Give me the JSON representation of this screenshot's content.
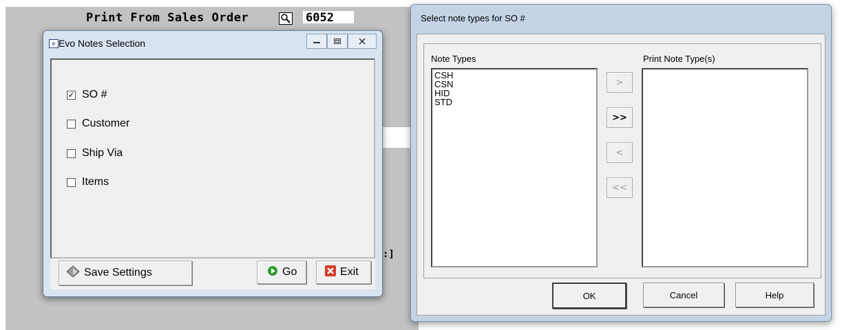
{
  "background_app": {
    "title_line": "Print From Sales Order",
    "order_number": "6052",
    "partial_text": ":]"
  },
  "evo_window": {
    "title": "Evo Notes Selection",
    "app_icon": "document-icon",
    "controls": {
      "minimize": "minimize-icon",
      "restore": "restore-icon",
      "close": "close-icon"
    },
    "checkboxes": [
      {
        "label": "SO #",
        "checked": true
      },
      {
        "label": "Customer",
        "checked": false
      },
      {
        "label": "Ship Via",
        "checked": false
      },
      {
        "label": "Items",
        "checked": false
      }
    ],
    "buttons": {
      "save_settings": "Save Settings",
      "go": "Go",
      "exit": "Exit"
    }
  },
  "note_dialog": {
    "title": "Select note types for SO #",
    "note_types_label": "Note Types",
    "print_note_types_label": "Print Note Type(s)",
    "note_types": [
      "CSH",
      "CSN",
      "HID",
      "STD"
    ],
    "print_note_types": [],
    "arrow_buttons": {
      "add_one": ">",
      "add_all": ">>",
      "remove_one": "<",
      "remove_all": "<<"
    },
    "buttons": {
      "ok": "OK",
      "cancel": "Cancel",
      "help": "Help"
    }
  },
  "colors": {
    "window_frame": "#d9e4f1",
    "dialog_frame": "#c4d4e6",
    "go_green": "#2e9b2e",
    "exit_red": "#d43a2a"
  }
}
